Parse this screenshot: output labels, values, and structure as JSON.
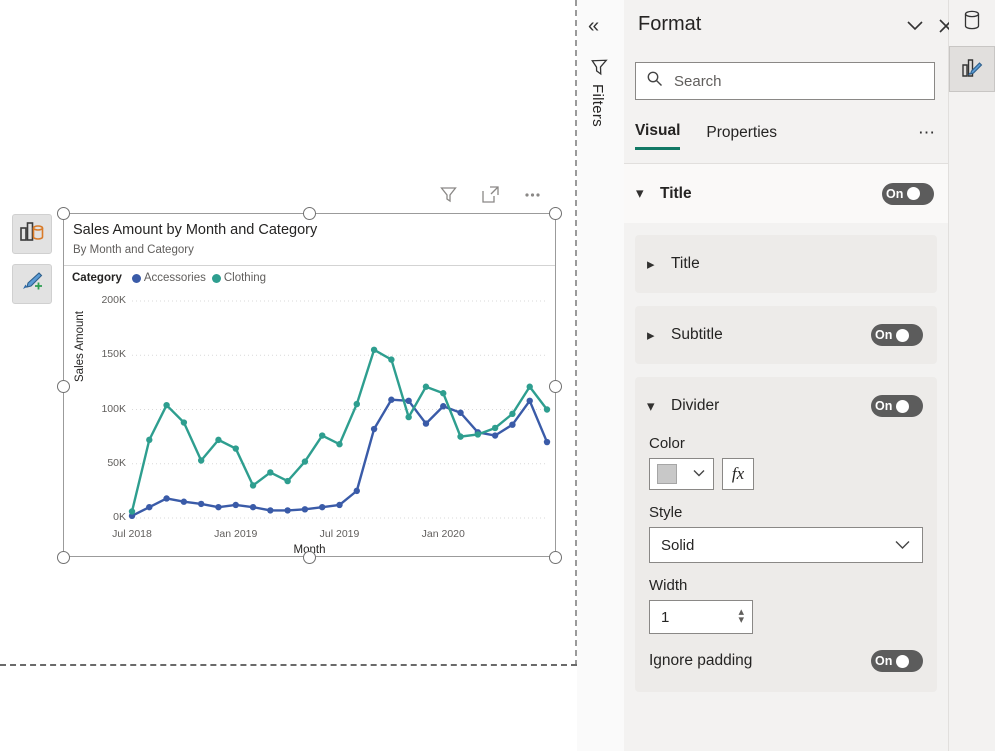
{
  "canvas": {
    "float_buttons": [
      {
        "name": "data-visual-switch",
        "icon": "bar-chart-database-icon"
      },
      {
        "name": "add-visual-brush",
        "icon": "paintbrush-plus-icon"
      }
    ],
    "visual_toolbar": [
      {
        "name": "filter-icon",
        "label": "Filters"
      },
      {
        "name": "focus-mode-icon",
        "label": "Focus mode"
      },
      {
        "name": "more-options-icon",
        "label": "More options"
      }
    ]
  },
  "filters_rail": {
    "collapse_label": "«",
    "title": "Filters"
  },
  "format": {
    "title": "Format",
    "collapse_icon": "chevron-down-icon",
    "close_icon": "close-icon",
    "search": {
      "placeholder": "Search",
      "value": ""
    },
    "tabs": [
      {
        "label": "Visual",
        "active": true
      },
      {
        "label": "Properties",
        "active": false
      }
    ],
    "tab_more": "⋯",
    "sections": {
      "title_group": {
        "label": "Title",
        "toggle": "On"
      },
      "title_card": {
        "label": "Title"
      },
      "subtitle_card": {
        "label": "Subtitle",
        "toggle": "On"
      },
      "divider_card": {
        "label": "Divider",
        "toggle": "On",
        "color_label": "Color",
        "color_value": "#C8C8C8",
        "fx_label": "fx",
        "style_label": "Style",
        "style_value": "Solid",
        "width_label": "Width",
        "width_value": "1",
        "ignore_padding_label": "Ignore padding",
        "ignore_padding_toggle": "On"
      }
    }
  },
  "icon_rail": [
    {
      "name": "data-pane-icon",
      "selected": false
    },
    {
      "name": "format-pane-icon",
      "selected": true
    }
  ],
  "chart_data": {
    "type": "line",
    "title": "Sales Amount by Month and Category",
    "subtitle": "By Month and Category",
    "xlabel": "Month",
    "ylabel": "Sales Amount",
    "legend_title": "Category",
    "legend_position": "top",
    "grid": true,
    "ylim": [
      0,
      200000
    ],
    "yticks": [
      0,
      50000,
      100000,
      150000,
      200000
    ],
    "ytick_labels": [
      "0K",
      "50K",
      "100K",
      "150K",
      "200K"
    ],
    "xtick_labels": [
      "Jul 2018",
      "Jan 2019",
      "Jul 2019",
      "Jan 2020"
    ],
    "xtick_indices": [
      0,
      6,
      12,
      18
    ],
    "x": [
      "Jul 2018",
      "Aug 2018",
      "Sep 2018",
      "Oct 2018",
      "Nov 2018",
      "Dec 2018",
      "Jan 2019",
      "Feb 2019",
      "Mar 2019",
      "Apr 2019",
      "May 2019",
      "Jun 2019",
      "Jul 2019",
      "Aug 2019",
      "Sep 2019",
      "Oct 2019",
      "Nov 2019",
      "Dec 2019",
      "Jan 2020",
      "Feb 2020",
      "Mar 2020",
      "Apr 2020",
      "May 2020",
      "Jun 2020"
    ],
    "series": [
      {
        "name": "Accessories",
        "color": "#3A5BA8",
        "values": [
          2000,
          10000,
          18000,
          15000,
          13000,
          10000,
          12000,
          10000,
          7000,
          7000,
          8000,
          10000,
          12000,
          25000,
          82000,
          109000,
          108000,
          87000,
          103000,
          97000,
          79000,
          76000,
          86000,
          108000,
          70000
        ]
      },
      {
        "name": "Clothing",
        "color": "#2E9E8F",
        "values": [
          6000,
          72000,
          104000,
          88000,
          53000,
          72000,
          64000,
          30000,
          42000,
          34000,
          52000,
          76000,
          68000,
          105000,
          155000,
          146000,
          93000,
          121000,
          115000,
          75000,
          77000,
          83000,
          96000,
          121000,
          100000
        ]
      }
    ]
  }
}
